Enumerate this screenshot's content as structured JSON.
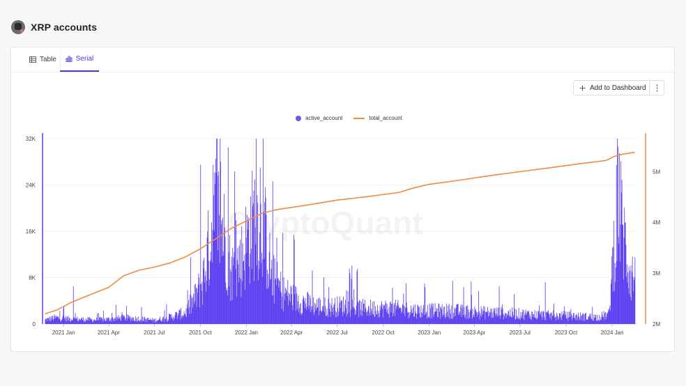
{
  "header": {
    "title": "XRP accounts",
    "avatar_icon": "coin-avatar-icon"
  },
  "tabs": [
    {
      "label": "Table",
      "icon": "table-icon",
      "active": false
    },
    {
      "label": "Serial",
      "icon": "bar-chart-icon",
      "active": true
    }
  ],
  "toolbar": {
    "add_label": "Add to Dashboard",
    "add_icon": "plus-icon",
    "more_icon": "kebab-menu-icon"
  },
  "watermark": "CryptoQuant",
  "colors": {
    "accent": "#4a35e0",
    "active_account": "#5b3cf0",
    "total_account": "#f08a42"
  },
  "chart_data": {
    "type": "bar+line",
    "legend": [
      {
        "name": "active_account",
        "style": "dot",
        "color": "#6a5ce6"
      },
      {
        "name": "total_account",
        "style": "line",
        "color": "#f08a42"
      }
    ],
    "legend_position": "top-center",
    "x_tick_labels": [
      "2021 Jan",
      "2021 Apr",
      "2021 Jul",
      "2021 Oct",
      "2022 Jan",
      "2022 Apr",
      "2022 Jul",
      "2022 Oct",
      "2023 Jan",
      "2023 Apr",
      "2023 Jul",
      "2023 Oct",
      "2024 Jan"
    ],
    "x_range": [
      "2020-11-20",
      "2024-02-20"
    ],
    "y_left": {
      "tick_labels": [
        "0",
        "8K",
        "16K",
        "24K",
        "32K"
      ],
      "ticks": [
        0,
        8000,
        16000,
        24000,
        32000
      ],
      "range": [
        0,
        32000
      ]
    },
    "y_right": {
      "tick_labels": [
        "2M",
        "3M",
        "4M",
        "5M"
      ],
      "ticks": [
        2000000,
        3000000,
        4000000,
        5000000
      ],
      "range": [
        2000000,
        5650000
      ]
    },
    "grid": true,
    "series": [
      {
        "name": "active_account",
        "kind": "bar",
        "axis": "left",
        "anchors": [
          [
            "2020-11-25",
            800
          ],
          [
            "2020-12-15",
            1200
          ],
          [
            "2021-01-10",
            1000
          ],
          [
            "2021-02-05",
            900
          ],
          [
            "2021-03-01",
            800
          ],
          [
            "2021-04-01",
            900
          ],
          [
            "2021-05-01",
            1200
          ],
          [
            "2021-06-01",
            1000
          ],
          [
            "2021-07-01",
            700
          ],
          [
            "2021-08-01",
            1300
          ],
          [
            "2021-09-01",
            2200
          ],
          [
            "2021-09-20",
            5000
          ],
          [
            "2021-10-05",
            8000
          ],
          [
            "2021-10-20",
            16000
          ],
          [
            "2021-11-01",
            22000
          ],
          [
            "2021-11-15",
            18000
          ],
          [
            "2021-12-01",
            10000
          ],
          [
            "2021-12-20",
            12000
          ],
          [
            "2022-01-05",
            17000
          ],
          [
            "2022-01-20",
            21000
          ],
          [
            "2022-02-05",
            18000
          ],
          [
            "2022-02-20",
            9000
          ],
          [
            "2022-03-15",
            6000
          ],
          [
            "2022-04-15",
            4500
          ],
          [
            "2022-05-15",
            3500
          ],
          [
            "2022-06-15",
            3200
          ],
          [
            "2022-07-15",
            3500
          ],
          [
            "2022-08-15",
            3000
          ],
          [
            "2022-10-15",
            3000
          ],
          [
            "2022-12-15",
            2500
          ],
          [
            "2023-02-15",
            2500
          ],
          [
            "2023-04-15",
            2200
          ],
          [
            "2023-06-15",
            2000
          ],
          [
            "2023-08-15",
            1700
          ],
          [
            "2023-10-15",
            1500
          ],
          [
            "2023-12-01",
            1300
          ],
          [
            "2023-12-25",
            1800
          ],
          [
            "2024-01-05",
            16000
          ],
          [
            "2024-01-12",
            24000
          ],
          [
            "2024-01-25",
            16000
          ],
          [
            "2024-02-05",
            10000
          ],
          [
            "2024-02-15",
            8500
          ]
        ],
        "spikes": [
          [
            "2021-01-20",
            6500
          ],
          [
            "2021-01-01",
            3000
          ],
          [
            "2021-10-01",
            27500
          ],
          [
            "2021-10-26",
            27500
          ],
          [
            "2021-11-10",
            28000
          ],
          [
            "2021-11-25",
            30500
          ],
          [
            "2022-01-28",
            27000
          ],
          [
            "2022-08-10",
            9500
          ],
          [
            "2024-01-15",
            29500
          ],
          [
            "2022-11-15",
            7000
          ],
          [
            "2023-05-20",
            6500
          ],
          [
            "2023-08-20",
            7200
          ]
        ]
      },
      {
        "name": "total_account",
        "kind": "line",
        "axis": "right",
        "points": [
          [
            "2020-11-25",
            2200000
          ],
          [
            "2020-12-20",
            2280000
          ],
          [
            "2021-01-15",
            2420000
          ],
          [
            "2021-03-01",
            2600000
          ],
          [
            "2021-04-01",
            2720000
          ],
          [
            "2021-05-01",
            2950000
          ],
          [
            "2021-06-01",
            3060000
          ],
          [
            "2021-07-01",
            3120000
          ],
          [
            "2021-08-01",
            3200000
          ],
          [
            "2021-09-01",
            3320000
          ],
          [
            "2021-10-01",
            3480000
          ],
          [
            "2021-11-01",
            3680000
          ],
          [
            "2021-12-01",
            3880000
          ],
          [
            "2022-01-01",
            4030000
          ],
          [
            "2022-02-01",
            4180000
          ],
          [
            "2022-03-01",
            4250000
          ],
          [
            "2022-05-01",
            4340000
          ],
          [
            "2022-07-01",
            4440000
          ],
          [
            "2022-09-01",
            4510000
          ],
          [
            "2022-11-01",
            4590000
          ],
          [
            "2022-12-01",
            4680000
          ],
          [
            "2023-01-01",
            4750000
          ],
          [
            "2023-03-01",
            4830000
          ],
          [
            "2023-05-01",
            4920000
          ],
          [
            "2023-07-01",
            5000000
          ],
          [
            "2023-09-01",
            5080000
          ],
          [
            "2023-11-01",
            5160000
          ],
          [
            "2023-12-20",
            5220000
          ],
          [
            "2024-01-05",
            5300000
          ],
          [
            "2024-01-20",
            5340000
          ],
          [
            "2024-02-15",
            5380000
          ]
        ]
      }
    ]
  }
}
